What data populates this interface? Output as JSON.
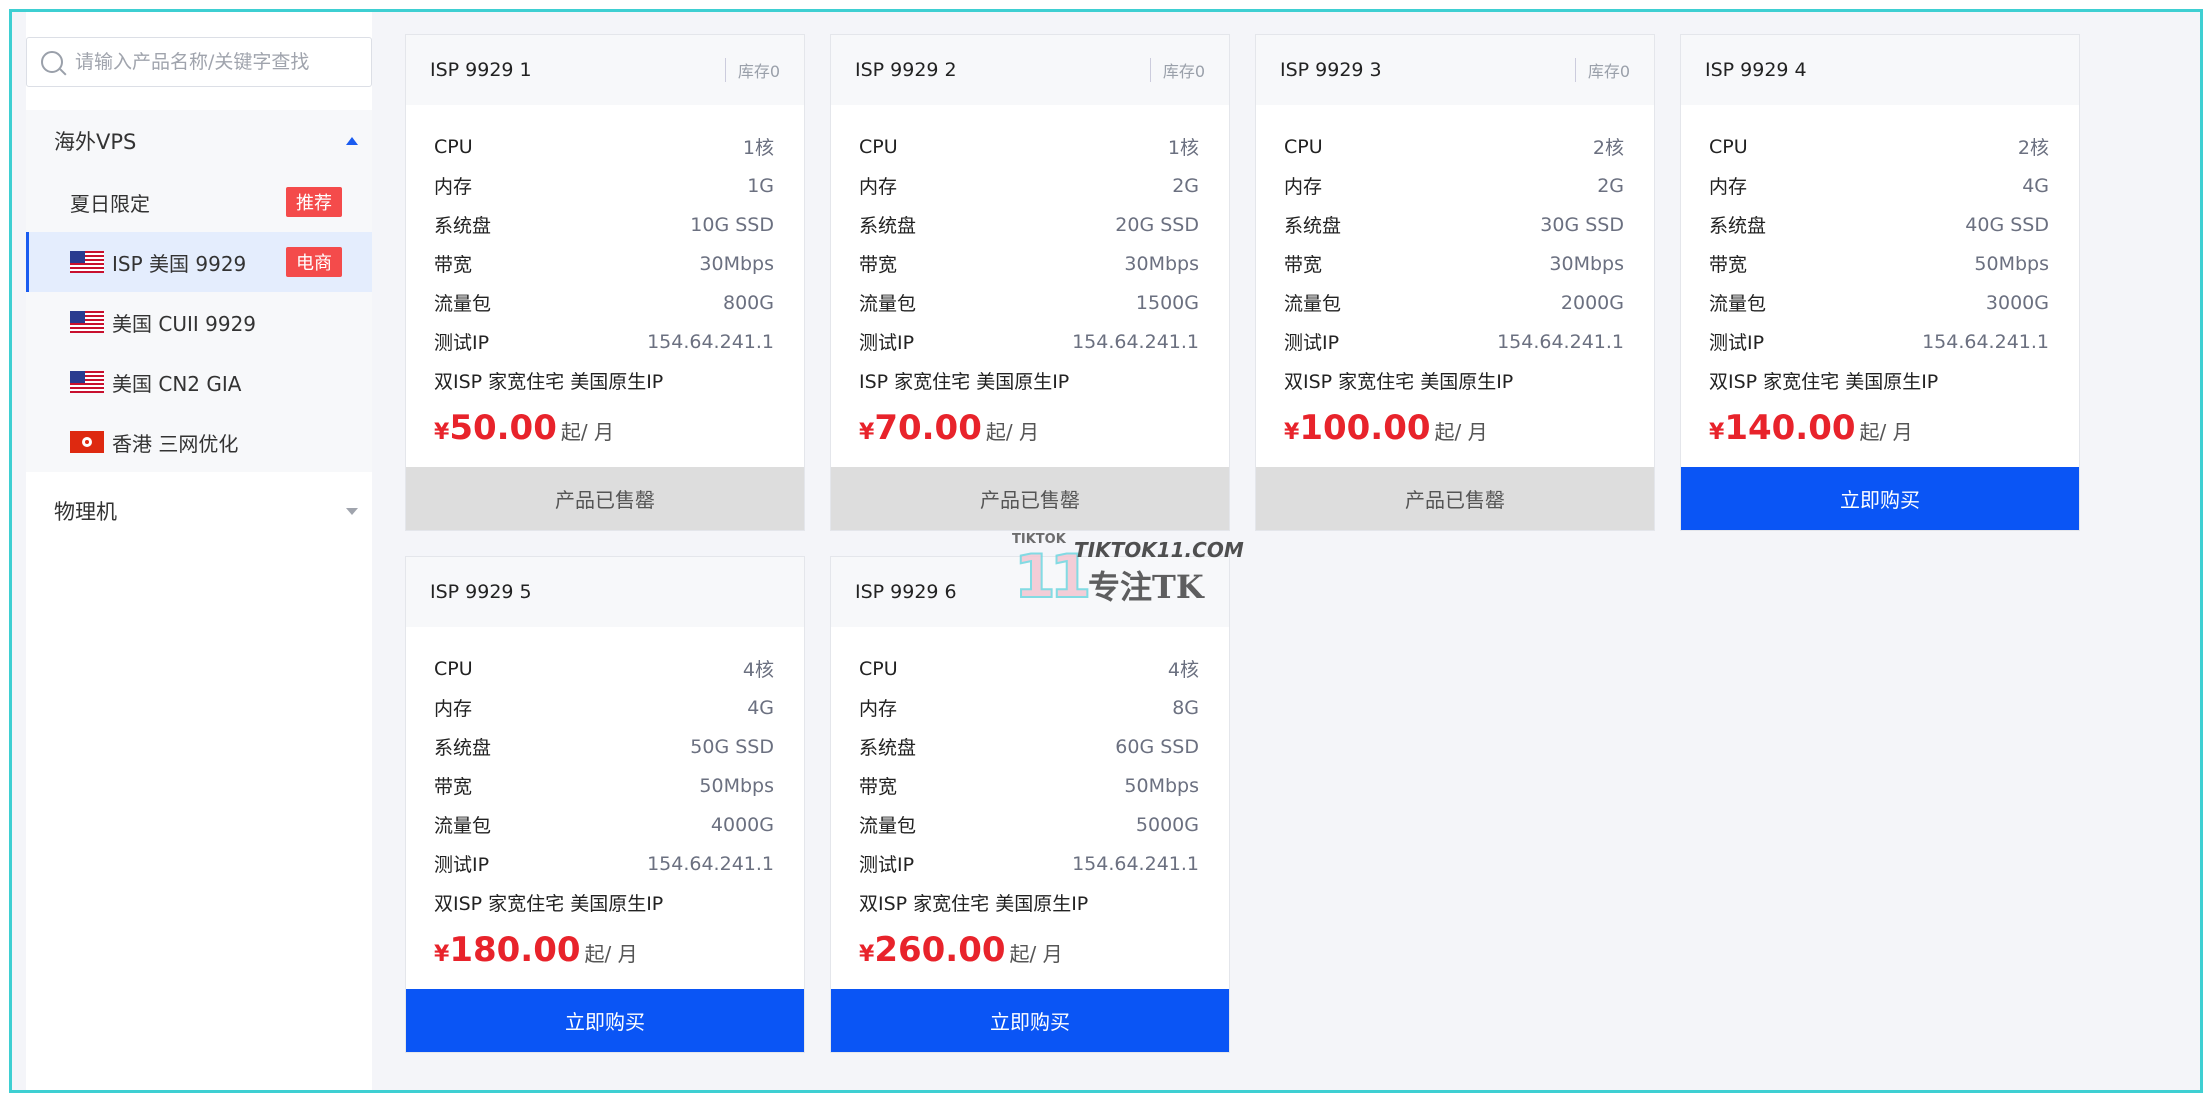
{
  "sidebar": {
    "search_placeholder": "请输入产品名称/关键字查找",
    "groups": [
      {
        "label": "海外VPS",
        "expanded": true,
        "items": [
          {
            "label": "夏日限定",
            "badge": "推荐",
            "flag": ""
          },
          {
            "label": "ISP 美国 9929",
            "badge": "电商",
            "flag": "us-flag-icon",
            "active": true
          },
          {
            "label": "美国 CUII 9929",
            "badge": "",
            "flag": "us-flag-icon"
          },
          {
            "label": "美国 CN2 GIA",
            "badge": "",
            "flag": "us-flag-icon"
          },
          {
            "label": "香港 三网优化",
            "badge": "",
            "flag": "hk-flag-icon"
          }
        ]
      },
      {
        "label": "物理机",
        "expanded": false
      }
    ]
  },
  "spec_labels": {
    "cpu": "CPU",
    "memory": "内存",
    "disk": "系统盘",
    "bandwidth": "带宽",
    "traffic": "流量包",
    "test_ip": "测试IP"
  },
  "price_suffix": "起/ 月",
  "currency": "¥",
  "cards": [
    {
      "title": "ISP 9929 1",
      "stock": "库存0",
      "cpu": "1核",
      "memory": "1G",
      "disk": "10G SSD",
      "bandwidth": "30Mbps",
      "traffic": "800G",
      "test_ip": "154.64.241.1",
      "desc": "双ISP 家宽住宅 美国原生IP",
      "price": "50.00",
      "button": "产品已售罄",
      "sold_out": true
    },
    {
      "title": "ISP 9929 2",
      "stock": "库存0",
      "cpu": "1核",
      "memory": "2G",
      "disk": "20G SSD",
      "bandwidth": "30Mbps",
      "traffic": "1500G",
      "test_ip": "154.64.241.1",
      "desc": "ISP 家宽住宅 美国原生IP",
      "price": "70.00",
      "button": "产品已售罄",
      "sold_out": true
    },
    {
      "title": "ISP 9929 3",
      "stock": "库存0",
      "cpu": "2核",
      "memory": "2G",
      "disk": "30G SSD",
      "bandwidth": "30Mbps",
      "traffic": "2000G",
      "test_ip": "154.64.241.1",
      "desc": "双ISP 家宽住宅 美国原生IP",
      "price": "100.00",
      "button": "产品已售罄",
      "sold_out": true
    },
    {
      "title": "ISP 9929 4",
      "stock": "",
      "cpu": "2核",
      "memory": "4G",
      "disk": "40G SSD",
      "bandwidth": "50Mbps",
      "traffic": "3000G",
      "test_ip": "154.64.241.1",
      "desc": "双ISP 家宽住宅 美国原生IP",
      "price": "140.00",
      "button": "立即购买",
      "sold_out": false
    },
    {
      "title": "ISP 9929 5",
      "stock": "",
      "cpu": "4核",
      "memory": "4G",
      "disk": "50G SSD",
      "bandwidth": "50Mbps",
      "traffic": "4000G",
      "test_ip": "154.64.241.1",
      "desc": "双ISP 家宽住宅 美国原生IP",
      "price": "180.00",
      "button": "立即购买",
      "sold_out": false
    },
    {
      "title": "ISP 9929 6",
      "stock": "",
      "cpu": "4核",
      "memory": "8G",
      "disk": "60G SSD",
      "bandwidth": "50Mbps",
      "traffic": "5000G",
      "test_ip": "154.64.241.1",
      "desc": "双ISP 家宽住宅 美国原生IP",
      "price": "260.00",
      "button": "立即购买",
      "sold_out": false
    }
  ],
  "watermark": {
    "small": "TIKTOK",
    "site": "TIKTOK11.COM",
    "number": "11",
    "tagline": "专注TK"
  },
  "colors": {
    "accent": "#0a55f5",
    "price": "#e8232b",
    "badge": "#f44b4b",
    "frame": "#3ecfd2"
  }
}
